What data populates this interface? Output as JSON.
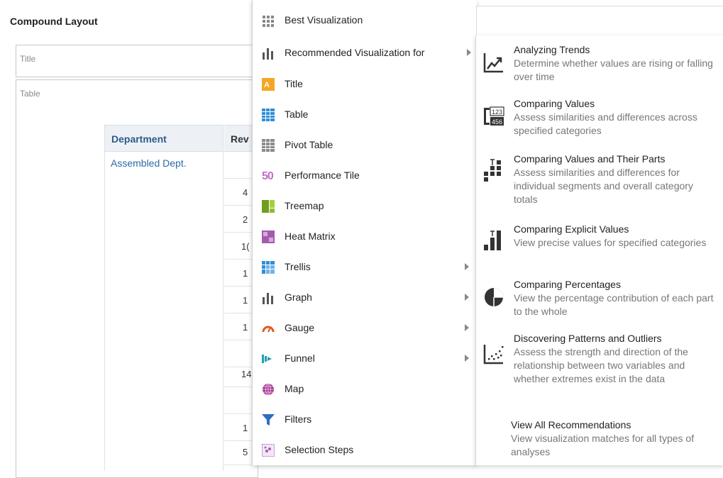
{
  "layout": {
    "compound_title": "Compound Layout",
    "title_view_label": "Title",
    "table_view_label": "Table"
  },
  "table": {
    "headers": [
      "Department",
      "Rev"
    ],
    "department": "Assembled Dept.",
    "revenue_partial": [
      "",
      "4",
      "2",
      "1(",
      "1",
      "1",
      "1",
      "",
      "14",
      "",
      "1",
      "5"
    ]
  },
  "menu": {
    "items": [
      {
        "label": "Best Visualization",
        "icon": "best-visualization-icon",
        "submenu": false
      },
      {
        "label": "Recommended Visualization for",
        "icon": "recommended-visualization-icon",
        "submenu": true
      },
      {
        "label": "Title",
        "icon": "title-icon",
        "submenu": false
      },
      {
        "label": "Table",
        "icon": "table-icon",
        "submenu": false
      },
      {
        "label": "Pivot Table",
        "icon": "pivot-table-icon",
        "submenu": false
      },
      {
        "label": "Performance Tile",
        "icon": "performance-tile-icon",
        "submenu": false
      },
      {
        "label": "Treemap",
        "icon": "treemap-icon",
        "submenu": false
      },
      {
        "label": "Heat Matrix",
        "icon": "heat-matrix-icon",
        "submenu": false
      },
      {
        "label": "Trellis",
        "icon": "trellis-icon",
        "submenu": true
      },
      {
        "label": "Graph",
        "icon": "graph-icon",
        "submenu": true
      },
      {
        "label": "Gauge",
        "icon": "gauge-icon",
        "submenu": true
      },
      {
        "label": "Funnel",
        "icon": "funnel-icon",
        "submenu": true
      },
      {
        "label": "Map",
        "icon": "map-icon",
        "submenu": false
      },
      {
        "label": "Filters",
        "icon": "filters-icon",
        "submenu": false
      },
      {
        "label": "Selection Steps",
        "icon": "selection-steps-icon",
        "submenu": false
      }
    ],
    "performance_tile_glyph": "50"
  },
  "submenu": {
    "items": [
      {
        "title": "Analyzing Trends",
        "desc": "Determine whether values are rising or falling over time",
        "icon": "analyzing-trends-icon"
      },
      {
        "title": "Comparing Values",
        "desc": "Assess similarities and differences across specified categories",
        "icon": "comparing-values-icon"
      },
      {
        "title": "Comparing Values and Their Parts",
        "desc": "Assess similarities and differences for individual segments and overall category totals",
        "icon": "comparing-parts-icon"
      },
      {
        "title": "Comparing Explicit Values",
        "desc": "View precise values for specified categories",
        "icon": "comparing-explicit-icon"
      },
      {
        "title": "Comparing Percentages",
        "desc": "View the percentage contribution of each part to the whole",
        "icon": "comparing-percentages-icon"
      },
      {
        "title": "Discovering Patterns and Outliers",
        "desc": "Assess the strength and direction of the relationship between two variables and whether extremes exist in the data",
        "icon": "patterns-outliers-icon"
      },
      {
        "title": "View All Recommendations",
        "desc": "View visualization matches for all types of analyses",
        "icon": ""
      }
    ],
    "cv_top": "123",
    "cv_bottom": "456"
  },
  "colors": {
    "title_icon": "#f5a623",
    "table_icon": "#2f8fd8",
    "performance_tile": "#c36fc8",
    "treemap_dark": "#6f9e1f",
    "treemap_light": "#a6cf3a",
    "heat_matrix": "#a55ab0",
    "gauge": "#e05a1e",
    "funnel": "#1f9fb0",
    "map": "#a0348f",
    "filters": "#2a6fc0",
    "link_blue": "#2d6aa5"
  }
}
